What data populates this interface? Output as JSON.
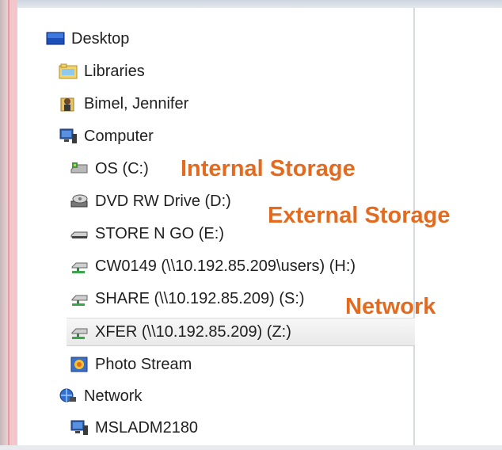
{
  "tree": [
    {
      "label": "Desktop",
      "icon": "desktop-icon"
    },
    {
      "label": "Libraries",
      "icon": "libraries-icon"
    },
    {
      "label": "Bimel, Jennifer",
      "icon": "user-folder-icon"
    },
    {
      "label": "Computer",
      "icon": "computer-icon"
    },
    {
      "label": "OS (C:)",
      "icon": "hard-drive-icon"
    },
    {
      "label": "DVD RW Drive (D:)",
      "icon": "dvd-drive-icon"
    },
    {
      "label": "STORE N GO (E:)",
      "icon": "usb-drive-icon"
    },
    {
      "label": "CW0149 (\\\\10.192.85.209\\users) (H:)",
      "icon": "network-drive-icon"
    },
    {
      "label": "SHARE (\\\\10.192.85.209) (S:)",
      "icon": "network-drive-icon"
    },
    {
      "label": "XFER (\\\\10.192.85.209) (Z:)",
      "icon": "network-drive-icon",
      "selected": true
    },
    {
      "label": "Photo Stream",
      "icon": "photo-stream-icon"
    },
    {
      "label": "Network",
      "icon": "network-icon"
    },
    {
      "label": "MSLADM2180",
      "icon": "computer-icon"
    }
  ],
  "annotations": {
    "internal": "Internal Storage",
    "external": "External Storage",
    "network": "Network"
  },
  "colors": {
    "annotation": "#e26b1f",
    "selection": "#ececec"
  }
}
